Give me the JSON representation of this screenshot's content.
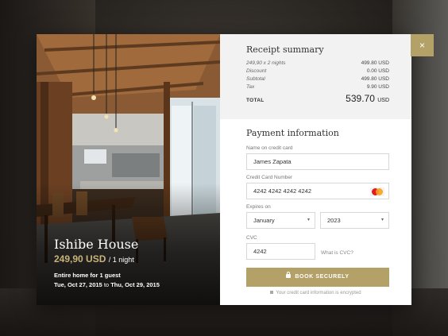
{
  "listing": {
    "name": "Ishibe House",
    "price": "249,90 USD",
    "price_unit": "/ 1 night",
    "guests_prefix": "Entire home for",
    "guests": "1 guest",
    "check_in": "Tue, Oct 27, 2015",
    "date_separator": "to",
    "check_out": "Thu, Oct 29, 2015"
  },
  "close_label": "×",
  "receipt": {
    "title": "Receipt summary",
    "rows": [
      {
        "label": "249,90 x 2 nights",
        "value": "499.80 USD"
      },
      {
        "label": "Discount",
        "value": "0.00 USD"
      },
      {
        "label": "Subtotal",
        "value": "499.80 USD"
      },
      {
        "label": "Tax",
        "value": "9.90 USD"
      }
    ],
    "total_label": "TOTAL",
    "total_amount": "539.70",
    "total_currency": "USD"
  },
  "payment": {
    "title": "Payment information",
    "name_label": "Name on credit card",
    "name_value": "James Zapata",
    "card_label": "Credit Card Number",
    "card_value": "4242 4242 4242 4242",
    "card_brand_icon": "mastercard-icon",
    "expires_label": "Expires on",
    "month_value": "January",
    "year_value": "2023",
    "cvc_label": "CVC",
    "cvc_value": "4242",
    "cvc_help": "What is CVC?",
    "book_label": "BOOK SECURELY",
    "encrypted_note": "Your credit card information is encrypted"
  },
  "colors": {
    "accent": "#b4a168",
    "price": "#c7b47a"
  }
}
